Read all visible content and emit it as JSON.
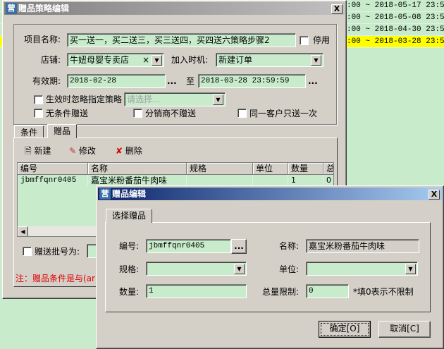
{
  "background_rows": [
    {
      "text": ":00 ~ 2018-05-17 23:59",
      "highlight": false
    },
    {
      "text": ":00 ~ 2018-05-08 23:59",
      "highlight": false
    },
    {
      "text": ":00 ~ 2018-04-30 23:59",
      "highlight": false
    },
    {
      "text": ":00 ~ 2018-03-28 23:59",
      "highlight": true
    }
  ],
  "main_dialog": {
    "title": "赠品策略编辑",
    "close": "X",
    "project_name_label": "项目名称:",
    "project_name": "买一送一，买二送三，买三送四，买四送六策略步骤2",
    "disable_label": "停用",
    "store_label": "店铺:",
    "store": "牛妞母婴专卖店",
    "clear": "×",
    "join_timing_label": "加入时机:",
    "join_timing": "新建订单",
    "validity_label": "有效期:",
    "start_date": "2018-02-28",
    "to_label": "至",
    "end_date": "2018-03-28 23:59:59",
    "ellipsis": "...",
    "ignore_label": "生效时忽略指定策略",
    "ignore_placeholder": "请选择...",
    "unconditional_label": "无条件赠送",
    "distributor_label": "分销商不赠送",
    "once_label": "同一客户只送一次",
    "tabs": [
      "条件",
      "赠品"
    ],
    "toolbar": {
      "new": "新建",
      "edit": "修改",
      "delete": "删除"
    },
    "table": {
      "columns": [
        "编号",
        "名称",
        "规格",
        "单位",
        "数量",
        "总"
      ],
      "rows": [
        [
          "jbmffqnr0405",
          "嘉宝米粉番茄牛肉味",
          "",
          "",
          "1",
          "0"
        ]
      ]
    },
    "batch_label": "赠送批号为:",
    "note": "注：赠品条件是与(ar"
  },
  "gift_dialog": {
    "title": "赠品编辑",
    "close": "X",
    "tab": "选择赠品",
    "code_label": "编号:",
    "code": "jbmffqnr0405",
    "browse": "...",
    "name_label": "名称:",
    "name": "嘉宝米粉番茄牛肉味",
    "spec_label": "规格:",
    "spec": "",
    "unit_label": "单位:",
    "unit": "",
    "qty_label": "数量:",
    "qty": "1",
    "limit_label": "总量限制:",
    "limit": "0",
    "limit_hint": "*填0表示不限制",
    "ok": "确定[O]",
    "cancel": "取消[C]"
  }
}
